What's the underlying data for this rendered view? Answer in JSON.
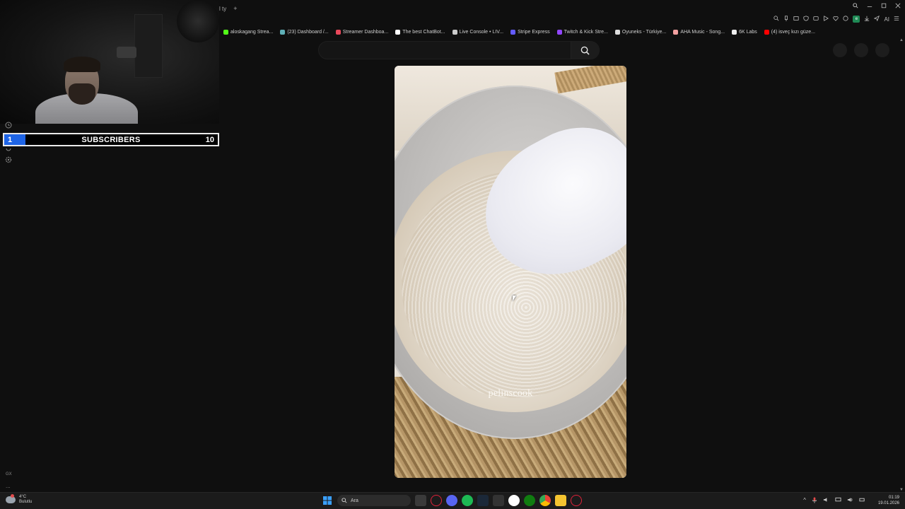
{
  "browser": {
    "tab_title": "l ty",
    "new_tab_symbol": "+",
    "bookmarks": [
      {
        "label": "aloskagang Strea...",
        "color": "#53fc18"
      },
      {
        "label": "(23) Dashboard /...",
        "color": "#5fb0b7"
      },
      {
        "label": "Streamer Dashboa...",
        "color": "#e9485b"
      },
      {
        "label": "The best ChatBot...",
        "color": "#ffffff"
      },
      {
        "label": "Live Console • LIV...",
        "color": "#cccccc"
      },
      {
        "label": "Stripe Express",
        "color": "#635bff"
      },
      {
        "label": "Twitch & Kick Stre...",
        "color": "#9146ff"
      },
      {
        "label": "Oyuneks - Türkiye...",
        "color": "#dddddd"
      },
      {
        "label": "AHA Music - Song...",
        "color": "#f2a0a0"
      },
      {
        "label": "6K Labs",
        "color": "#eeeeee"
      },
      {
        "label": "(4) isveç kızı güze...",
        "color": "#ff0000"
      }
    ],
    "ai_label": "AI",
    "ext_badge": "e"
  },
  "search": {
    "placeholder": ""
  },
  "subscribers": {
    "current": "1",
    "label": "SUBSCRIBERS",
    "goal": "10",
    "progress": 0.1
  },
  "video": {
    "watermark": "pelinscook"
  },
  "taskbar": {
    "weather_temp": "4°C",
    "weather_desc": "Bulutlu",
    "search_label": "Ara",
    "time": "01:19",
    "date": "19.01.2026"
  },
  "sidebar": {
    "gx_label": "GX",
    "more_label": "..."
  },
  "colors": {
    "subs_fill": "#1e64e6",
    "accent": "#1f8a55"
  }
}
